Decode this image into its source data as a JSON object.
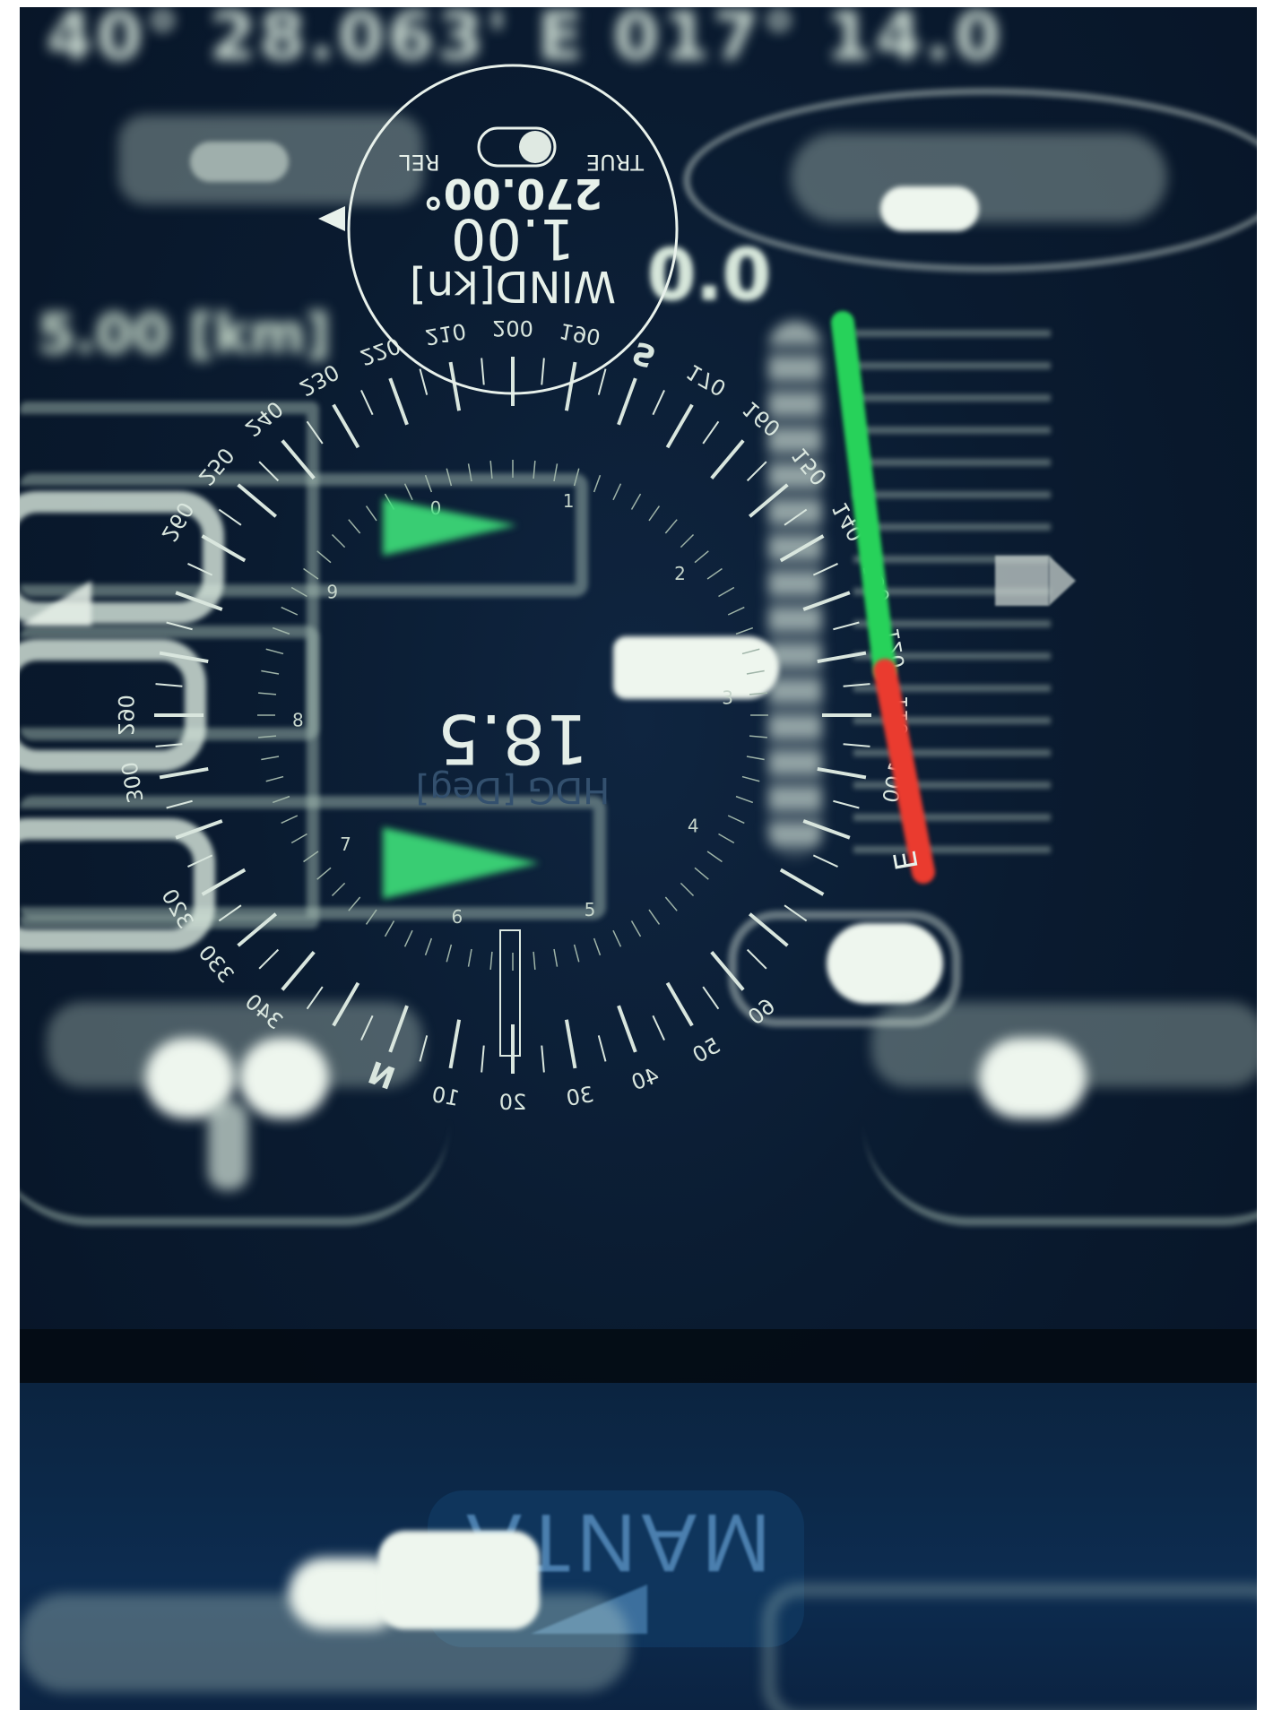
{
  "coords_line": "40° 28.063' E 017° 14.0",
  "wind_panel": {
    "mode_left": "REL",
    "mode_right": "TRUE",
    "direction": "270.00°",
    "speed": "1.00",
    "unit_label": "WIND[kn]",
    "mode": "TRUE"
  },
  "heading": {
    "value": "18.5",
    "unit_label": "HDG [Deg]"
  },
  "side_readouts": {
    "top_right_value": "0.0",
    "depth_label": "5.00 [km]"
  },
  "compass_ticks": {
    "degrees": [
      "10",
      "20",
      "30",
      "40",
      "50",
      "60",
      "100",
      "110",
      "120",
      "130",
      "140",
      "150",
      "160",
      "170",
      "S",
      "190",
      "200",
      "210",
      "220",
      "230",
      "240",
      "250",
      "260",
      "290",
      "300",
      "320",
      "330",
      "340",
      "N"
    ]
  },
  "inner_ring_labels": [
    "1",
    "2",
    "3",
    "4",
    "5",
    "6",
    "7",
    "8",
    "9",
    "0"
  ],
  "gauge": {
    "label": "E",
    "colors": {
      "green": "#27d25a",
      "red": "#ea3b2f"
    }
  },
  "brand": "MANTA",
  "colors": {
    "background": "#0a1b30",
    "accent_green": "#3ee07a",
    "ink": "#e4eee8"
  }
}
